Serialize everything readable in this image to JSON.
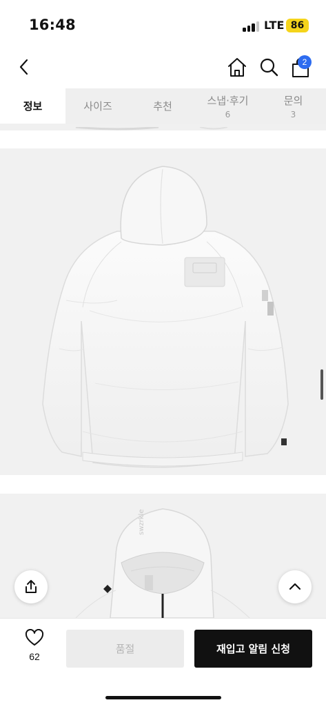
{
  "status_bar": {
    "time": "16:48",
    "network": "LTE",
    "battery": "86",
    "battery_color": "#f5d41b"
  },
  "nav": {
    "back_icon": "chevron-left-icon",
    "home_icon": "home-icon",
    "search_icon": "search-icon",
    "cart_icon": "shopping-bag-icon",
    "cart_count": "2",
    "badge_color": "#2d6cf0"
  },
  "tabs": [
    {
      "label": "정보",
      "count": ""
    },
    {
      "label": "사이즈",
      "count": ""
    },
    {
      "label": "추천",
      "count": ""
    },
    {
      "label": "스냅·후기",
      "count": "6"
    },
    {
      "label": "문의",
      "count": "3"
    }
  ],
  "floating": {
    "share_icon": "share-icon",
    "scroll_top_icon": "chevron-up-icon"
  },
  "bottom_bar": {
    "like_icon": "heart-icon",
    "like_count": "62",
    "soldout_label": "품절",
    "restock_label": "재입고 알림 신청"
  },
  "product_images": [
    {
      "view": "jacket-back",
      "color": "white"
    },
    {
      "view": "jacket-hood-front",
      "color": "white",
      "hood_text": "swzrkle"
    }
  ]
}
